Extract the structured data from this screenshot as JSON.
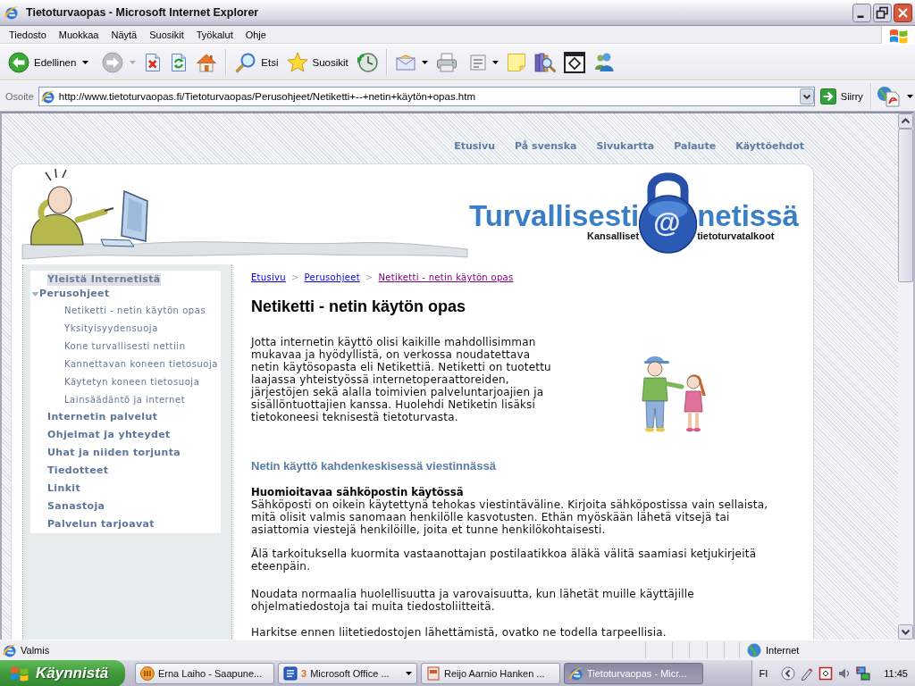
{
  "window": {
    "title": "Tietoturvaopas - Microsoft Internet Explorer"
  },
  "menu": [
    "Tiedosto",
    "Muokkaa",
    "Näytä",
    "Suosikit",
    "Työkalut",
    "Ohje"
  ],
  "toolbar": {
    "back": {
      "label": "Edellinen",
      "disabled": false
    },
    "forward": {
      "disabled": true
    },
    "search": {
      "label": "Etsi"
    },
    "favorites": {
      "label": "Suosikit"
    }
  },
  "address_bar": {
    "label": "Osoite",
    "value": "http://www.tietoturvaopas.fi/Tietoturvaopas/Perusohjeet/Netiketti+--+netin+käytön+opas.htm",
    "go_label": "Siirry"
  },
  "page": {
    "top_links": [
      "Etusivu",
      "På svenska",
      "Sivukartta",
      "Palaute",
      "Käyttöehdot"
    ],
    "logo": {
      "title_left": "Turvallisesti",
      "symbol": "@",
      "title_right": "netissä",
      "tagline_left": "Kansalliset",
      "tagline_right": "tietoturvatalkoot"
    },
    "sidebar": {
      "items": [
        {
          "label": "Yleistä Internetistä",
          "highlighted": true
        },
        {
          "label": "Perusohjeet",
          "highlighted": false,
          "expanded": true,
          "children": [
            {
              "label": "Netiketti - netin käytön opas"
            },
            {
              "label": "Yksityisyydensuoja"
            },
            {
              "label": "Kone turvallisesti nettiin"
            },
            {
              "label": "Kannettavan koneen tietosuoja"
            },
            {
              "label": "Käytetyn koneen tietosuoja"
            },
            {
              "label": "Lainsäädäntö ja internet"
            }
          ]
        },
        {
          "label": "Internetin palvelut",
          "highlighted": false
        },
        {
          "label": "Ohjelmat ja yhteydet",
          "highlighted": false
        },
        {
          "label": "Uhat ja niiden torjunta",
          "highlighted": false
        },
        {
          "label": "Tiedotteet",
          "highlighted": false
        },
        {
          "label": "Linkit",
          "highlighted": false
        },
        {
          "label": "Sanastoja",
          "highlighted": false
        },
        {
          "label": "Palvelun tarjoavat",
          "highlighted": false
        }
      ]
    },
    "content": {
      "breadcrumb": [
        {
          "kind": "link",
          "label": "Etusivu",
          "visited": false
        },
        {
          "kind": "separator",
          "text": ">"
        },
        {
          "kind": "link",
          "label": "Perusohjeet",
          "visited": false
        },
        {
          "kind": "separator",
          "text": ">"
        },
        {
          "kind": "link",
          "label": "Netiketti - netin käytön opas",
          "visited": true
        }
      ],
      "title": "Netiketti - netin käytön opas",
      "intro": "Jotta internetin käyttö olisi kaikille mahdollisimman mukavaa ja hyödyllistä, on verkossa noudatettava netin käytösopasta eli Netikettiä. Netiketti on tuotettu laajassa yhteistyössä internetoperaattoreiden, järjestöjen sekä alalla toimivien palveluntarjoajien ja sisällöntuottajien kanssa. Huolehdi Netiketin lisäksi tietokoneesi teknisestä tietoturvasta.",
      "section_heading": "Netin käyttö kahdenkeskisessä viestinnässä",
      "subheading": "Huomioitavaa sähköpostin käytössä",
      "paragraphs": [
        "Sähköposti on oikein käytettynä tehokas viestintäväline. Kirjoita sähköpostissa vain sellaista, mitä olisit valmis sanomaan henkilölle kasvotusten. Ethän myöskään lähetä vitsejä tai asiattomia viestejä henkilöille, joita et tunne henkilökohtaisesti.",
        "Älä tarkoituksella kuormita vastaanottajan postilaatikkoa äläkä välitä saamiasi ketjukirjeitä eteenpäin.",
        "Noudata normaalia huolellisuutta ja varovaisuutta, kun lähetät muille käyttäjille ohjelmatiedostoja tai muita tiedostoliitteitä.",
        "Harkitse ennen liitetiedostojen lähettämistä, ovatko ne todella tarpeellisia."
      ]
    }
  },
  "status_bar": {
    "text": "Valmis",
    "zone": "Internet"
  },
  "taskbar": {
    "start_label": "Käynnistä",
    "tasks": [
      {
        "kind": "mail",
        "label": "Erna Laiho - Saapune...",
        "selected": false
      },
      {
        "kind": "group",
        "count": "3",
        "label": "Microsoft Office ...",
        "selected": false
      },
      {
        "kind": "document",
        "label": "Reijo Aarnio Hanken ...",
        "selected": false
      },
      {
        "kind": "browser",
        "label": "Tietoturvaopas - Micr...",
        "selected": true
      }
    ],
    "language": "FI",
    "clock": "11:45"
  }
}
